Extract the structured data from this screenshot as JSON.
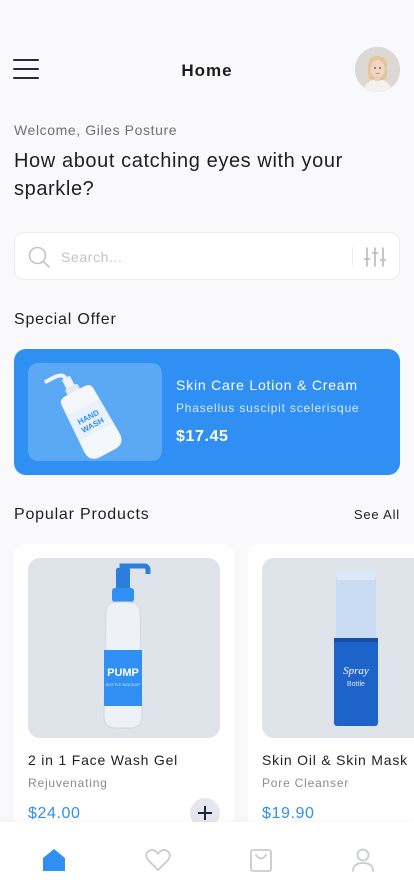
{
  "header": {
    "title": "Home",
    "menu_icon": "hamburger-menu-icon",
    "avatar": "user-avatar"
  },
  "greeting": {
    "welcome": "Welcome, Giles Posture",
    "headline": "How about catching eyes with your sparkle?"
  },
  "search": {
    "placeholder": "Search...",
    "icon": "search-icon",
    "filter_icon": "filter-sliders-icon"
  },
  "special_offer": {
    "section_title": "Special Offer",
    "product_name": "Skin Care Lotion & Cream",
    "description": "Phasellus suscipit scelerisque",
    "price": "$17.45",
    "image_label_top": "HAND",
    "image_label_bottom": "WASH"
  },
  "popular": {
    "section_title": "Popular Products",
    "see_all": "See All",
    "products": [
      {
        "name": "2 in 1 Face Wash Gel",
        "subtitle": "Rejuvenating",
        "price": "$24.00",
        "label_main": "PUMP",
        "label_sub": "BOTTLE MOCKUP"
      },
      {
        "name": "Skin Oil & Skin Mask",
        "subtitle": "Pore Cleanser",
        "price": "$19.90",
        "label_main": "Spray",
        "label_sub": "Bottle"
      }
    ]
  },
  "bottom_nav": {
    "items": [
      {
        "icon": "home-icon",
        "active": true
      },
      {
        "icon": "heart-icon",
        "active": false
      },
      {
        "icon": "bag-icon",
        "active": false
      },
      {
        "icon": "profile-icon",
        "active": false
      }
    ]
  },
  "colors": {
    "accent": "#2f8ff2",
    "background": "#f9f9fb",
    "nav_inactive": "#c9cbd1"
  }
}
